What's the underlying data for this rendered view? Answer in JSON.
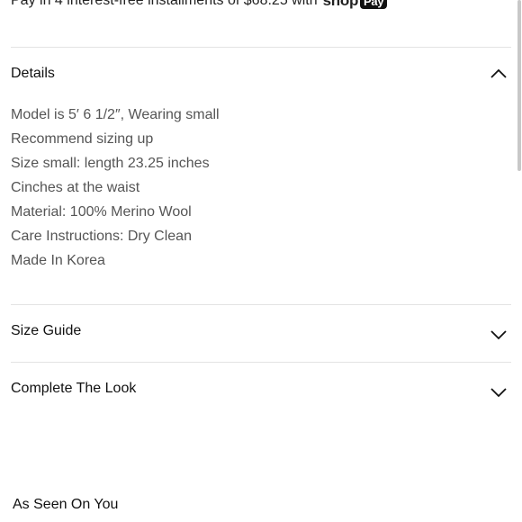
{
  "installments": {
    "text": "Pay in 4 interest-free installments of $68.25 with",
    "brand_shop": "shop",
    "brand_pay": "Pay"
  },
  "sections": {
    "details": {
      "title": "Details",
      "expanded": true,
      "icon": "chevron-up-icon",
      "items": [
        "Model is 5′ 6 1/2″, Wearing small",
        "Recommend sizing up",
        "Size small: length 23.25 inches",
        "Cinches at the waist",
        "Material: 100% Merino Wool",
        "Care Instructions: Dry Clean",
        "Made In Korea"
      ]
    },
    "size_guide": {
      "title": "Size Guide",
      "expanded": false,
      "icon": "chevron-down-icon"
    },
    "complete_the_look": {
      "title": "Complete The Look",
      "expanded": false,
      "icon": "chevron-down-icon"
    }
  },
  "as_seen_on_you": {
    "title": "As Seen On You"
  }
}
